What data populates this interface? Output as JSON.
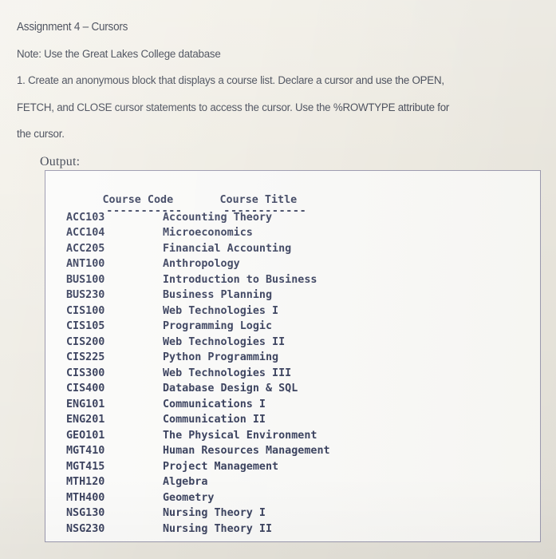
{
  "document": {
    "title": "Assignment  4 – Cursors",
    "note": "Note: Use the Great Lakes College database",
    "instruction_lines": [
      "1. Create an anonymous block that displays a course list. Declare a cursor and use the OPEN,",
      "FETCH, and CLOSE cursor statements to access the cursor. Use the %ROWTYPE attribute for",
      "the cursor."
    ],
    "output_label": "Output:"
  },
  "colors": {
    "page_background": "#efece3",
    "console_background": "#f7f7f5",
    "console_border": "#9a98ad",
    "prose_text": "#464b58",
    "console_text": "#3d4460"
  },
  "console": {
    "headers": {
      "code": "Course Code",
      "title": "Course Title"
    },
    "rules": {
      "code": "-----------",
      "title": "------------"
    },
    "rows": [
      {
        "code": "ACC103",
        "title": "Accounting Theory"
      },
      {
        "code": "ACC104",
        "title": "Microeconomics"
      },
      {
        "code": "ACC205",
        "title": "Financial Accounting"
      },
      {
        "code": "ANT100",
        "title": "Anthropology"
      },
      {
        "code": "BUS100",
        "title": "Introduction to Business"
      },
      {
        "code": "BUS230",
        "title": "Business Planning"
      },
      {
        "code": "CIS100",
        "title": "Web Technologies I"
      },
      {
        "code": "CIS105",
        "title": "Programming Logic"
      },
      {
        "code": "CIS200",
        "title": "Web Technologies II"
      },
      {
        "code": "CIS225",
        "title": "Python Programming"
      },
      {
        "code": "CIS300",
        "title": "Web Technologies III"
      },
      {
        "code": "CIS400",
        "title": "Database Design & SQL"
      },
      {
        "code": "ENG101",
        "title": "Communications I"
      },
      {
        "code": "ENG201",
        "title": "Communication II"
      },
      {
        "code": "GEO101",
        "title": "The Physical Environment"
      },
      {
        "code": "MGT410",
        "title": "Human Resources Management"
      },
      {
        "code": "MGT415",
        "title": "Project Management"
      },
      {
        "code": "MTH120",
        "title": "Algebra"
      },
      {
        "code": "MTH400",
        "title": "Geometry"
      },
      {
        "code": "NSG130",
        "title": "Nursing Theory I"
      },
      {
        "code": "NSG230",
        "title": "Nursing Theory II"
      }
    ]
  }
}
